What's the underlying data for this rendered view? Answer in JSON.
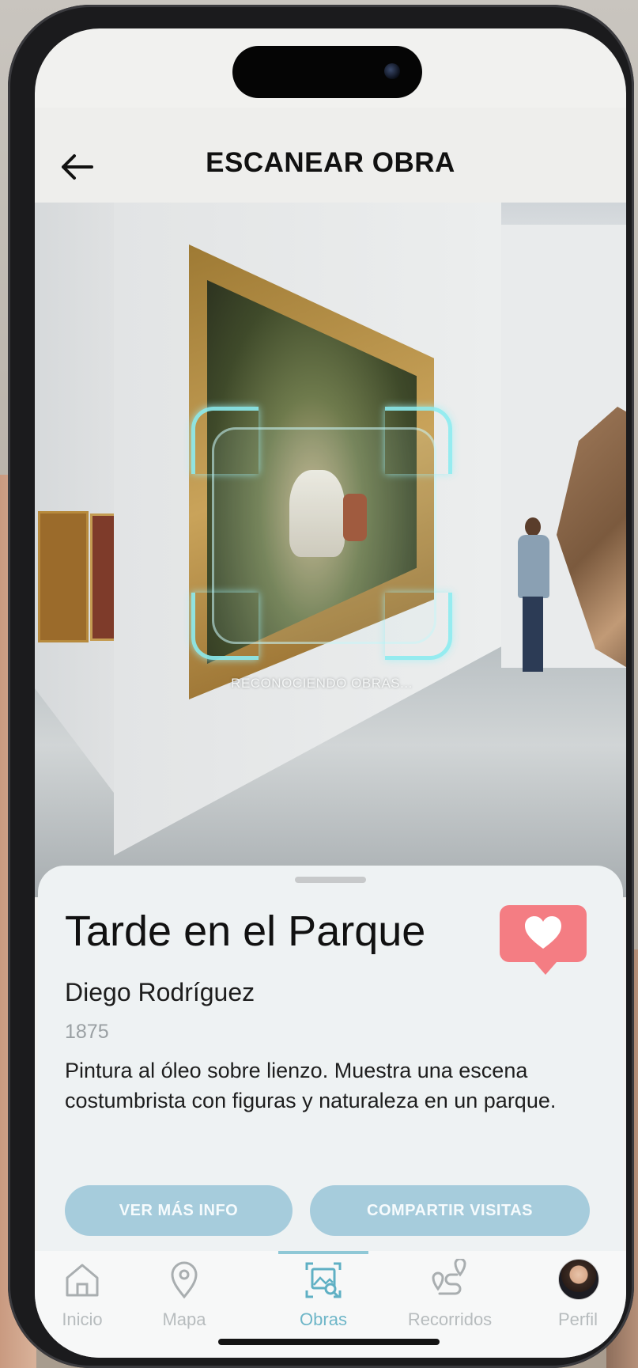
{
  "header": {
    "title": "ESCANEAR OBRA",
    "back_icon": "arrow-left-icon"
  },
  "scanner": {
    "status_text": "RECONOCIENDO OBRAS..."
  },
  "artwork": {
    "title": "Tarde en el Parque",
    "artist": "Diego Rodríguez",
    "year": "1875",
    "description": "Pintura al óleo sobre lienzo. Muestra una escena costumbrista con figuras y naturaleza en un parque.",
    "favorite_icon": "heart-icon"
  },
  "actions": {
    "more_info_label": "VER MÁS INFO",
    "share_label": "COMPARTIR VISITAS"
  },
  "tabs": [
    {
      "label": "Inicio",
      "icon": "home-icon",
      "active": false
    },
    {
      "label": "Mapa",
      "icon": "map-pin-icon",
      "active": false
    },
    {
      "label": "Obras",
      "icon": "scan-artwork-icon",
      "active": true
    },
    {
      "label": "Recorridos",
      "icon": "route-icon",
      "active": false
    },
    {
      "label": "Perfil",
      "icon": "avatar",
      "active": false
    }
  ],
  "colors": {
    "accent": "#6eb6c8",
    "button_bg": "#a6ccdc",
    "favorite_bg": "#f47d83",
    "scan_frame": "#8cebf0"
  }
}
